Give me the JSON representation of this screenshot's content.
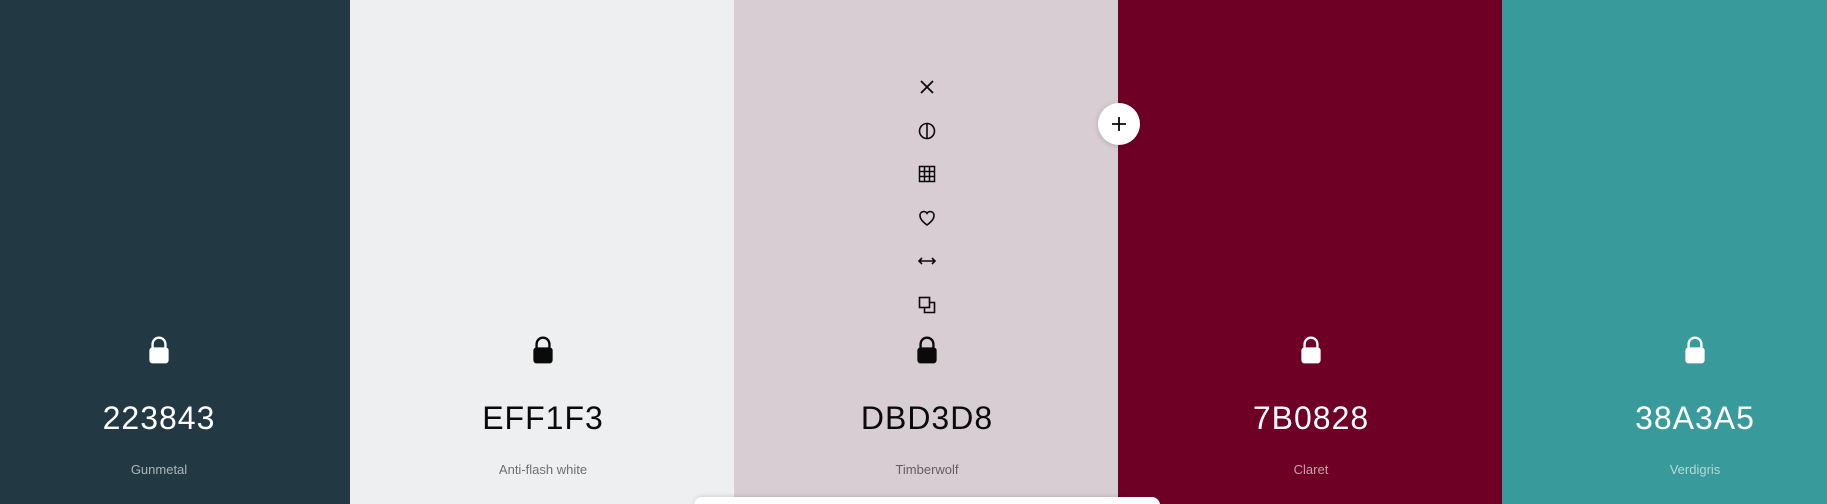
{
  "swatches": [
    {
      "hex": "223843",
      "name": "Gunmetal",
      "color": "#223843",
      "text_tone": "light",
      "lock_icon": "lock-icon"
    },
    {
      "hex": "EFF1F3",
      "name": "Anti-flash white",
      "color": "#EFF1F3",
      "text_tone": "dark",
      "lock_icon": "lock-icon"
    },
    {
      "hex": "DBD3D8",
      "name": "Timberwolf",
      "color": "#DBD3D8",
      "text_tone": "dark",
      "lock_icon": "lock-icon"
    },
    {
      "hex": "7B0828",
      "name": "Claret",
      "color": "#6E0025",
      "text_tone": "light",
      "lock_icon": "lock-icon"
    },
    {
      "hex": "38A3A5",
      "name": "Verdigris",
      "color": "#389A9A",
      "text_tone": "light",
      "lock_icon": "lock-icon"
    }
  ],
  "hover_toolbar": {
    "tools": [
      "close-icon",
      "contrast-icon",
      "shades-grid-icon",
      "heart-icon",
      "drag-arrows-icon",
      "copy-icon"
    ]
  },
  "add_button": {
    "icon": "plus-icon"
  }
}
